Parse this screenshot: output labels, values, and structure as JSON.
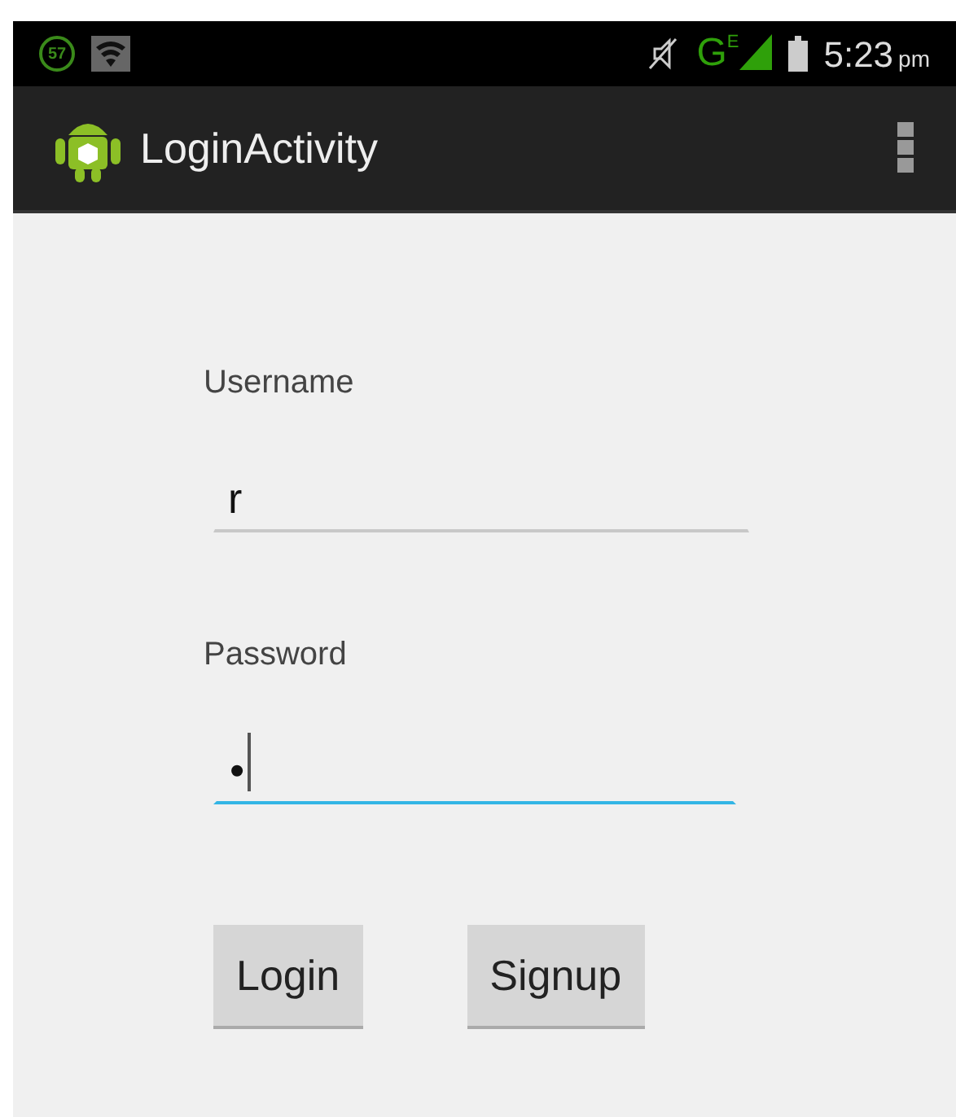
{
  "status_bar": {
    "notification_badge": "57",
    "network": "G",
    "network_type": "E",
    "time": "5:23",
    "time_suffix": "pm"
  },
  "action_bar": {
    "title": "LoginActivity"
  },
  "fields": [
    {
      "label": "Username",
      "value": "r",
      "focused": false
    },
    {
      "label": "Password",
      "value": "•",
      "focused": true
    }
  ],
  "buttons": [
    "Login",
    "Signup"
  ]
}
